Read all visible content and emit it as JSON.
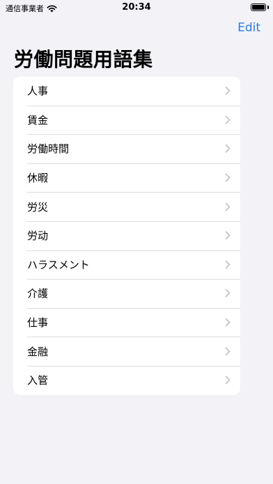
{
  "status_bar": {
    "carrier": "通信事業者",
    "time": "20:34"
  },
  "nav": {
    "edit_label": "Edit"
  },
  "page": {
    "title": "労働問題用語集"
  },
  "list": {
    "items": [
      {
        "label": "人事"
      },
      {
        "label": "賃金"
      },
      {
        "label": "労働時間"
      },
      {
        "label": "休暇"
      },
      {
        "label": "労災"
      },
      {
        "label": "労动"
      },
      {
        "label": "ハラスメント"
      },
      {
        "label": "介護"
      },
      {
        "label": "仕事"
      },
      {
        "label": "金融"
      },
      {
        "label": "入管"
      }
    ]
  },
  "icons": {
    "wifi": "wifi-icon",
    "battery": "battery-icon",
    "chevron": "chevron-right-icon"
  },
  "colors": {
    "accent": "#2f7bd6",
    "background": "#f2f2f7",
    "chevron": "#c4c4c7"
  }
}
